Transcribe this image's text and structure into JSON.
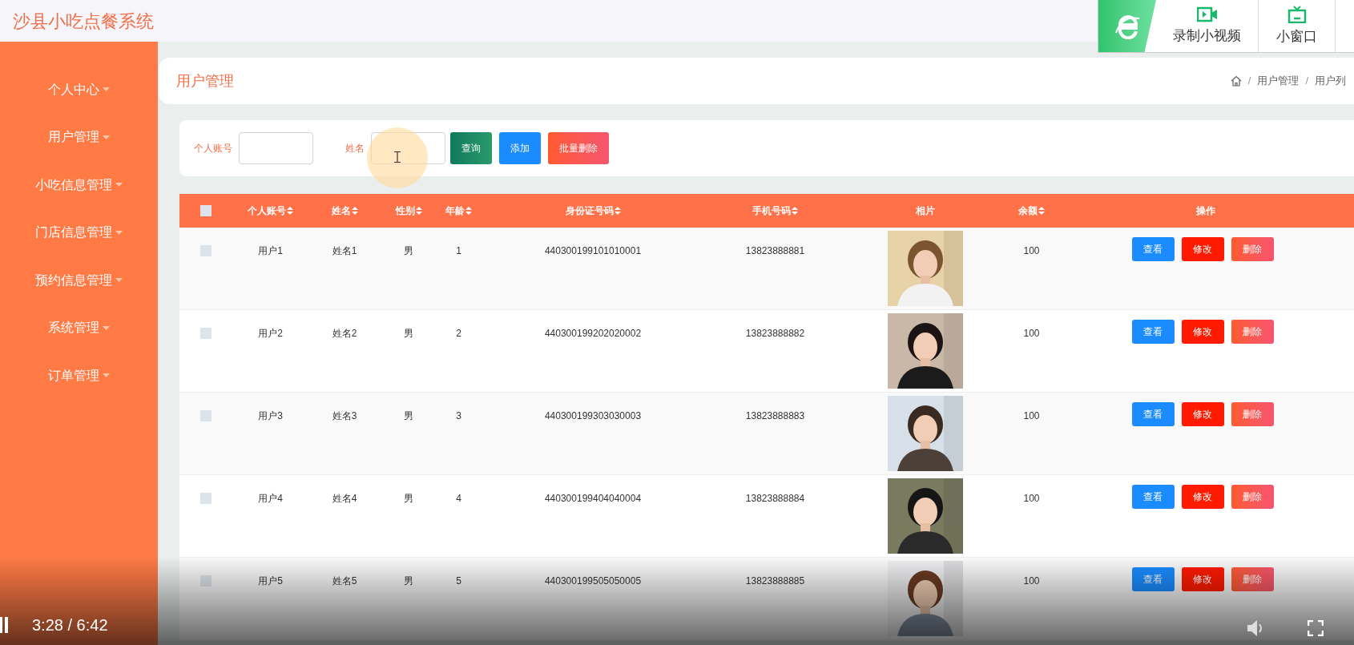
{
  "app_title": "沙县小吃点餐系统",
  "sidebar": {
    "items": [
      {
        "label": "个人中心"
      },
      {
        "label": "用户管理"
      },
      {
        "label": "小吃信息管理"
      },
      {
        "label": "门店信息管理"
      },
      {
        "label": "预约信息管理"
      },
      {
        "label": "系统管理"
      },
      {
        "label": "订单管理"
      }
    ]
  },
  "page_title": "用户管理",
  "breadcrumb": {
    "separator": "/",
    "items": [
      "用户管理",
      "用户列"
    ]
  },
  "search": {
    "fields": [
      {
        "label": "个人账号"
      },
      {
        "label": "姓名"
      }
    ],
    "buttons": [
      {
        "label": "查询",
        "kind": "query"
      },
      {
        "label": "添加",
        "kind": "add"
      },
      {
        "label": "批量删除",
        "kind": "delete"
      }
    ]
  },
  "table": {
    "select_all": {
      "checked": false
    },
    "columns": [
      {
        "label": "个人账号",
        "sortable": true
      },
      {
        "label": "姓名",
        "sortable": true
      },
      {
        "label": "性别",
        "sortable": true
      },
      {
        "label": "年龄",
        "sortable": true
      },
      {
        "label": "身份证号码",
        "sortable": true
      },
      {
        "label": "手机号码",
        "sortable": true
      },
      {
        "label": "相片",
        "sortable": false
      },
      {
        "label": "余额",
        "sortable": true
      },
      {
        "label": "操作",
        "sortable": false
      }
    ],
    "rows": [
      {
        "checked": false,
        "account": "用户1",
        "name": "姓名1",
        "gender": "男",
        "age": "1",
        "id_number": "440300199101010001",
        "phone": "13823888881",
        "balance": "100",
        "actions": [
          "查看",
          "修改",
          "删除"
        ]
      },
      {
        "checked": false,
        "account": "用户2",
        "name": "姓名2",
        "gender": "男",
        "age": "2",
        "id_number": "440300199202020002",
        "phone": "13823888882",
        "balance": "100",
        "actions": [
          "查看",
          "修改",
          "删除"
        ]
      },
      {
        "checked": false,
        "account": "用户3",
        "name": "姓名3",
        "gender": "男",
        "age": "3",
        "id_number": "440300199303030003",
        "phone": "13823888883",
        "balance": "100",
        "actions": [
          "查看",
          "修改",
          "删除"
        ]
      },
      {
        "checked": false,
        "account": "用户4",
        "name": "姓名4",
        "gender": "男",
        "age": "4",
        "id_number": "440300199404040004",
        "phone": "13823888884",
        "balance": "100",
        "actions": [
          "查看",
          "修改",
          "删除"
        ]
      },
      {
        "checked": false,
        "account": "用户5",
        "name": "姓名5",
        "gender": "男",
        "age": "5",
        "id_number": "440300199505050005",
        "phone": "13823888885",
        "balance": "100",
        "actions": [
          "查看",
          "修改",
          "删除"
        ]
      }
    ]
  },
  "recorder_toolbar": {
    "buttons": [
      {
        "label": "录制小视频",
        "kind": "record"
      },
      {
        "label": "小窗口",
        "kind": "window"
      }
    ]
  },
  "player": {
    "playing": true,
    "time": "3:28 / 6:42"
  }
}
